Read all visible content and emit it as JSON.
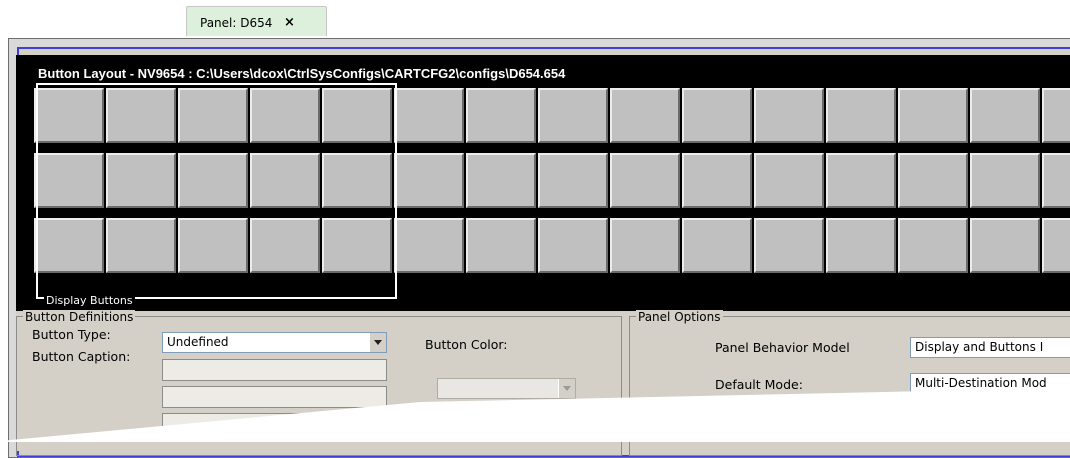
{
  "tab": {
    "label": "Panel: D654",
    "close_glyph": "×"
  },
  "layout": {
    "title": "Button Layout - NV9654 : C:\\Users\\dcox\\CtrlSysConfigs\\CARTCFG2\\configs\\D654.654",
    "display_buttons_label": "Display Buttons",
    "rows": 3,
    "columns": 15
  },
  "button_definitions": {
    "group_title": "Button Definitions",
    "button_type_label": "Button Type:",
    "button_type_value": "Undefined",
    "button_caption_label": "Button Caption:",
    "button_color_label": "Button Color:",
    "button_color_value": ""
  },
  "panel_options": {
    "group_title": "Panel Options",
    "behavior_label": "Panel Behavior Model",
    "behavior_value": "Display and Buttons I",
    "default_mode_label": "Default Mode:",
    "default_mode_value": "Multi-Destination Mod"
  },
  "colors": {
    "frame_blue": "#4040d8",
    "panel_black": "#000000",
    "button_gray": "#c0c0c0",
    "tab_green": "#dcf0dc"
  }
}
